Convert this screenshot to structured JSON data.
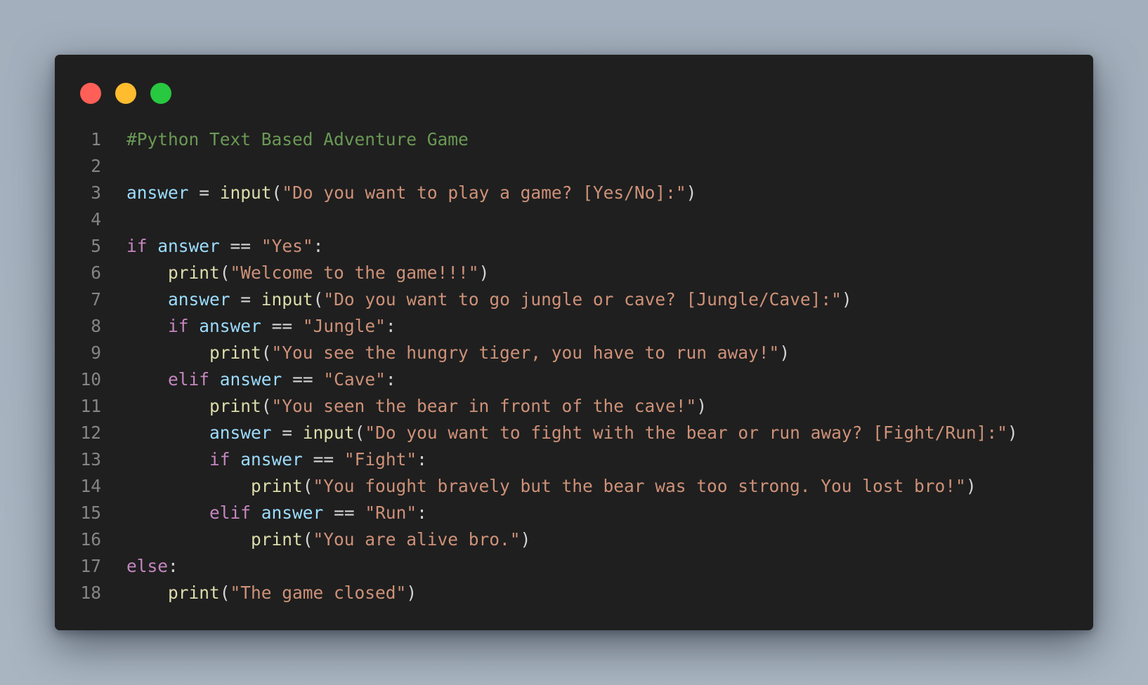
{
  "window": {
    "controls": [
      {
        "name": "close",
        "color": "#ff5f57"
      },
      {
        "name": "minimize",
        "color": "#febc2e"
      },
      {
        "name": "maximize",
        "color": "#28c840"
      }
    ]
  },
  "colors": {
    "comment": "#6a9955",
    "variable": "#9cdcfe",
    "function": "#dcdcaa",
    "string": "#ce9178",
    "keyword": "#c586c0",
    "operator": "#d4d4d4",
    "line_number": "#858585",
    "background": "#1f1f1f"
  },
  "code": {
    "language": "python",
    "lines": [
      {
        "number": "1",
        "tokens": [
          {
            "t": "comment",
            "v": "#Python Text Based Adventure Game"
          }
        ]
      },
      {
        "number": "2",
        "tokens": []
      },
      {
        "number": "3",
        "tokens": [
          {
            "t": "var",
            "v": "answer"
          },
          {
            "t": "op",
            "v": " = "
          },
          {
            "t": "func",
            "v": "input"
          },
          {
            "t": "punc",
            "v": "("
          },
          {
            "t": "str",
            "v": "\"Do you want to play a game? [Yes/No]:\""
          },
          {
            "t": "punc",
            "v": ")"
          }
        ]
      },
      {
        "number": "4",
        "tokens": []
      },
      {
        "number": "5",
        "tokens": [
          {
            "t": "kw",
            "v": "if"
          },
          {
            "t": "op",
            "v": " "
          },
          {
            "t": "var",
            "v": "answer"
          },
          {
            "t": "op",
            "v": " == "
          },
          {
            "t": "str",
            "v": "\"Yes\""
          },
          {
            "t": "punc",
            "v": ":"
          }
        ]
      },
      {
        "number": "6",
        "tokens": [
          {
            "t": "op",
            "v": "    "
          },
          {
            "t": "func",
            "v": "print"
          },
          {
            "t": "punc",
            "v": "("
          },
          {
            "t": "str",
            "v": "\"Welcome to the game!!!\""
          },
          {
            "t": "punc",
            "v": ")"
          }
        ]
      },
      {
        "number": "7",
        "tokens": [
          {
            "t": "op",
            "v": "    "
          },
          {
            "t": "var",
            "v": "answer"
          },
          {
            "t": "op",
            "v": " = "
          },
          {
            "t": "func",
            "v": "input"
          },
          {
            "t": "punc",
            "v": "("
          },
          {
            "t": "str",
            "v": "\"Do you want to go jungle or cave? [Jungle/Cave]:\""
          },
          {
            "t": "punc",
            "v": ")"
          }
        ]
      },
      {
        "number": "8",
        "tokens": [
          {
            "t": "op",
            "v": "    "
          },
          {
            "t": "kw",
            "v": "if"
          },
          {
            "t": "op",
            "v": " "
          },
          {
            "t": "var",
            "v": "answer"
          },
          {
            "t": "op",
            "v": " == "
          },
          {
            "t": "str",
            "v": "\"Jungle\""
          },
          {
            "t": "punc",
            "v": ":"
          }
        ]
      },
      {
        "number": "9",
        "tokens": [
          {
            "t": "op",
            "v": "        "
          },
          {
            "t": "func",
            "v": "print"
          },
          {
            "t": "punc",
            "v": "("
          },
          {
            "t": "str",
            "v": "\"You see the hungry tiger, you have to run away!\""
          },
          {
            "t": "punc",
            "v": ")"
          }
        ]
      },
      {
        "number": "10",
        "tokens": [
          {
            "t": "op",
            "v": "    "
          },
          {
            "t": "kw",
            "v": "elif"
          },
          {
            "t": "op",
            "v": " "
          },
          {
            "t": "var",
            "v": "answer"
          },
          {
            "t": "op",
            "v": " == "
          },
          {
            "t": "str",
            "v": "\"Cave\""
          },
          {
            "t": "punc",
            "v": ":"
          }
        ]
      },
      {
        "number": "11",
        "tokens": [
          {
            "t": "op",
            "v": "        "
          },
          {
            "t": "func",
            "v": "print"
          },
          {
            "t": "punc",
            "v": "("
          },
          {
            "t": "str",
            "v": "\"You seen the bear in front of the cave!\""
          },
          {
            "t": "punc",
            "v": ")"
          }
        ]
      },
      {
        "number": "12",
        "tokens": [
          {
            "t": "op",
            "v": "        "
          },
          {
            "t": "var",
            "v": "answer"
          },
          {
            "t": "op",
            "v": " = "
          },
          {
            "t": "func",
            "v": "input"
          },
          {
            "t": "punc",
            "v": "("
          },
          {
            "t": "str",
            "v": "\"Do you want to fight with the bear or run away? [Fight/Run]:\""
          },
          {
            "t": "punc",
            "v": ")"
          }
        ]
      },
      {
        "number": "13",
        "tokens": [
          {
            "t": "op",
            "v": "        "
          },
          {
            "t": "kw",
            "v": "if"
          },
          {
            "t": "op",
            "v": " "
          },
          {
            "t": "var",
            "v": "answer"
          },
          {
            "t": "op",
            "v": " == "
          },
          {
            "t": "str",
            "v": "\"Fight\""
          },
          {
            "t": "punc",
            "v": ":"
          }
        ]
      },
      {
        "number": "14",
        "tokens": [
          {
            "t": "op",
            "v": "            "
          },
          {
            "t": "func",
            "v": "print"
          },
          {
            "t": "punc",
            "v": "("
          },
          {
            "t": "str",
            "v": "\"You fought bravely but the bear was too strong. You lost bro!\""
          },
          {
            "t": "punc",
            "v": ")"
          }
        ]
      },
      {
        "number": "15",
        "tokens": [
          {
            "t": "op",
            "v": "        "
          },
          {
            "t": "kw",
            "v": "elif"
          },
          {
            "t": "op",
            "v": " "
          },
          {
            "t": "var",
            "v": "answer"
          },
          {
            "t": "op",
            "v": " == "
          },
          {
            "t": "str",
            "v": "\"Run\""
          },
          {
            "t": "punc",
            "v": ":"
          }
        ]
      },
      {
        "number": "16",
        "tokens": [
          {
            "t": "op",
            "v": "            "
          },
          {
            "t": "func",
            "v": "print"
          },
          {
            "t": "punc",
            "v": "("
          },
          {
            "t": "str",
            "v": "\"You are alive bro.\""
          },
          {
            "t": "punc",
            "v": ")"
          }
        ]
      },
      {
        "number": "17",
        "tokens": [
          {
            "t": "kw",
            "v": "else"
          },
          {
            "t": "punc",
            "v": ":"
          }
        ]
      },
      {
        "number": "18",
        "tokens": [
          {
            "t": "op",
            "v": "    "
          },
          {
            "t": "func",
            "v": "print"
          },
          {
            "t": "punc",
            "v": "("
          },
          {
            "t": "str",
            "v": "\"The game closed\""
          },
          {
            "t": "punc",
            "v": ")"
          }
        ]
      }
    ]
  }
}
